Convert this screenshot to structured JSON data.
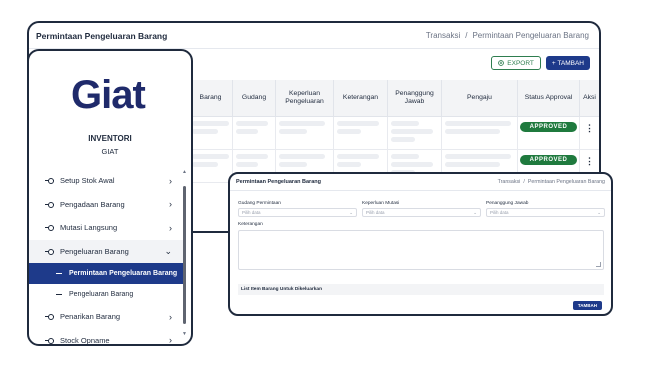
{
  "main": {
    "title": "Permintaan Pengeluaran Barang",
    "breadcrumb": [
      "Transaksi",
      "/",
      "Permintaan Pengeluaran Barang"
    ],
    "export_label": "EXPORT",
    "add_label": "+ TAMBAH",
    "table": {
      "headers": [
        "Barang",
        "Gudang",
        "Keperluan Pengeluaran",
        "Keterangan",
        "Penanggung Jawab",
        "Pengaju",
        "Status Approval",
        "Aksi"
      ],
      "rows": [
        {
          "status": "APPROVED",
          "action": "⋮"
        },
        {
          "status": "APPROVED",
          "action": "⋮"
        }
      ]
    }
  },
  "sidebar": {
    "logo": "Giat",
    "app_name": "INVENTORI",
    "app_sub": "GIAT",
    "items": [
      {
        "label": "Setup Stok Awal",
        "chevron": "›"
      },
      {
        "label": "Pengadaan Barang",
        "chevron": "›"
      },
      {
        "label": "Mutasi Langsung",
        "chevron": "›"
      },
      {
        "label": "Pengeluaran Barang",
        "chevron": "⌄"
      },
      {
        "label": "Penarikan Barang",
        "chevron": "›"
      },
      {
        "label": "Stock Opname",
        "chevron": "›"
      }
    ],
    "subitems": [
      {
        "label": "Permintaan Pengeluaran Barang"
      },
      {
        "label": "Pengeluaran Barang"
      }
    ]
  },
  "form": {
    "title": "Permintaan Pengeluaran Barang",
    "breadcrumb": [
      "Transaksi",
      "/",
      "Permintaan Pengeluaran Barang"
    ],
    "fields": [
      {
        "label": "Gudang Permintaan",
        "placeholder": "Pilih data"
      },
      {
        "label": "Keperluan Mutasi",
        "placeholder": "Pilih data"
      },
      {
        "label": "Penanggung Jawab",
        "placeholder": "Pilih data"
      }
    ],
    "keterangan_label": "Keterangan",
    "list_title": "List Item Barang Untuk Dikeluarkan",
    "add_label": "TAMBAH"
  },
  "colors": {
    "brand": "#1e3a8a",
    "approved": "#1f7a3e",
    "export": "#2e7d4f",
    "text": "#1f2a3d"
  },
  "icons": {
    "export": "export-icon",
    "add": "plus-icon",
    "kebab": "kebab-menu-icon",
    "menu_dot": "node-icon"
  }
}
